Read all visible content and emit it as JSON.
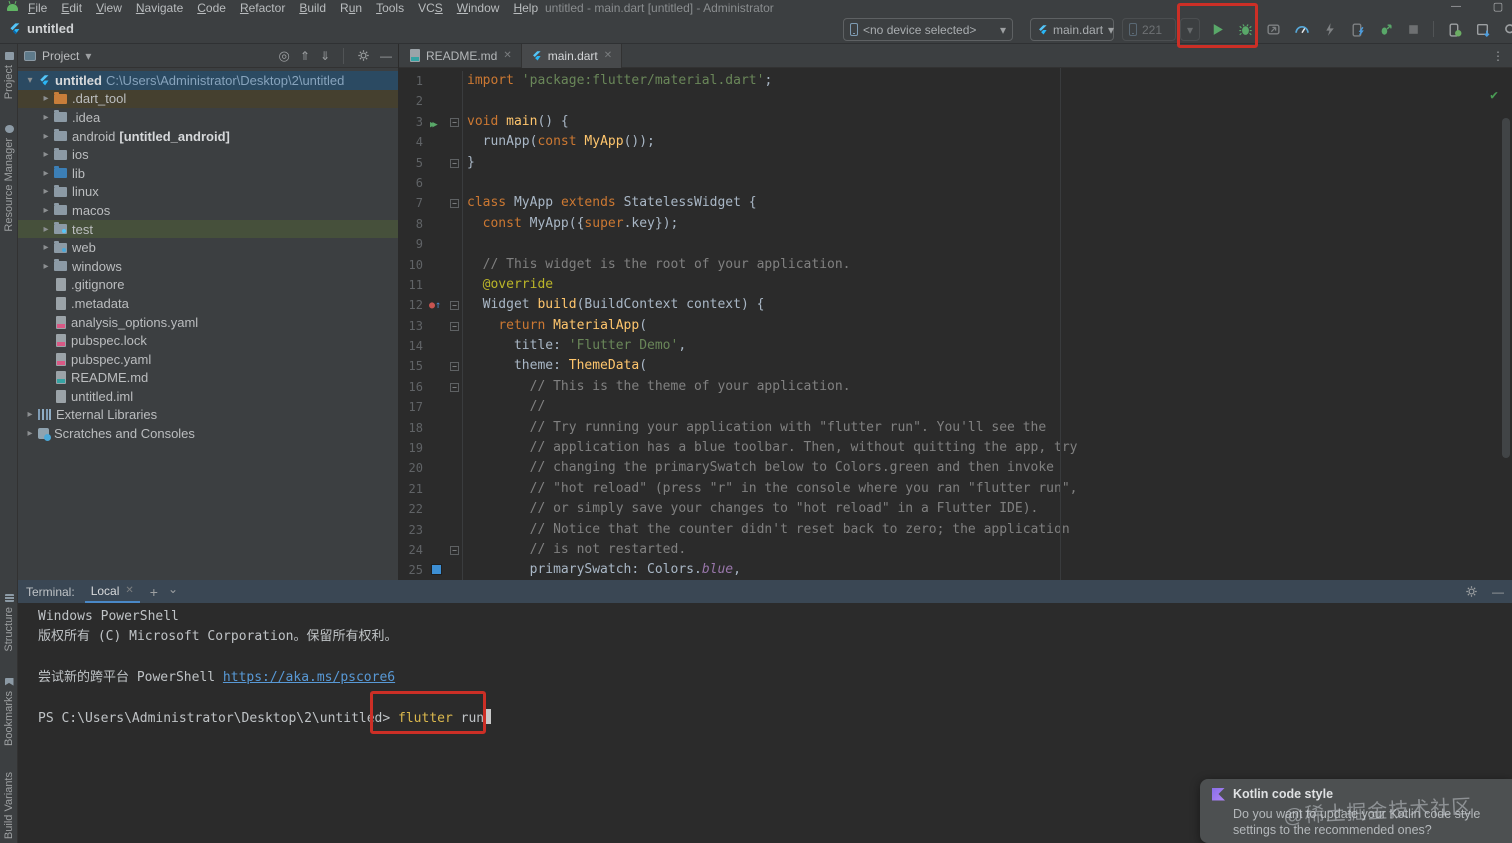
{
  "window": {
    "title": "untitled - main.dart [untitled] - Administrator"
  },
  "menubar": {
    "items": [
      {
        "label": "File",
        "m": 0
      },
      {
        "label": "Edit",
        "m": 0
      },
      {
        "label": "View",
        "m": 0
      },
      {
        "label": "Navigate",
        "m": 0
      },
      {
        "label": "Code",
        "m": 0
      },
      {
        "label": "Refactor",
        "m": 0
      },
      {
        "label": "Build",
        "m": 0
      },
      {
        "label": "Run",
        "m": 1
      },
      {
        "label": "Tools",
        "m": 0
      },
      {
        "label": "VCS",
        "m": 2
      },
      {
        "label": "Window",
        "m": 0
      },
      {
        "label": "Help",
        "m": 0
      }
    ]
  },
  "navbar": {
    "breadcrumb": "untitled"
  },
  "toolbar": {
    "device_selector": "<no device selected>",
    "run_config": "main.dart",
    "api_level": "221",
    "action_icons": [
      "profile-icon",
      "devtools-icon",
      "hot-reload-icon",
      "attach-debugger-icon",
      "flutter-attach-icon",
      "stop-icon",
      "device-manager-icon",
      "sdk-manager-icon",
      "search-icon",
      "settings-icon"
    ]
  },
  "left_stripe": {
    "top": [
      {
        "label": "Project"
      },
      {
        "label": "Resource Manager"
      }
    ],
    "bottom": [
      {
        "label": "Structure"
      },
      {
        "label": "Bookmarks"
      },
      {
        "label": "Build Variants"
      }
    ]
  },
  "project_panel": {
    "header": {
      "title": "Project"
    },
    "tree": [
      {
        "label": "untitled",
        "suffix": "C:\\Users\\Administrator\\Desktop\\2\\untitled",
        "icon": "flutter",
        "chev": "open",
        "level": 0,
        "bg": "sel-blue",
        "bold": true,
        "suffixClass": "path-suffix"
      },
      {
        "label": ".dart_tool",
        "icon": "folder-orange",
        "chev": "closed",
        "level": 1,
        "bg": "row-brown"
      },
      {
        "label": ".idea",
        "icon": "folder",
        "chev": "closed",
        "level": 1
      },
      {
        "label": "android",
        "suffix": "[untitled_android]",
        "icon": "folder",
        "chev": "closed",
        "level": 1,
        "suffixClass": "bold"
      },
      {
        "label": "ios",
        "icon": "folder",
        "chev": "closed",
        "level": 1
      },
      {
        "label": "lib",
        "icon": "folder-blue",
        "chev": "closed",
        "level": 1
      },
      {
        "label": "linux",
        "icon": "folder",
        "chev": "closed",
        "level": 1
      },
      {
        "label": "macos",
        "icon": "folder",
        "chev": "closed",
        "level": 1
      },
      {
        "label": "test",
        "icon": "folder-test",
        "chev": "closed",
        "level": 1,
        "bg": "row-olive"
      },
      {
        "label": "web",
        "icon": "folder-web",
        "chev": "closed",
        "level": 1
      },
      {
        "label": "windows",
        "icon": "folder",
        "chev": "closed",
        "level": 1
      },
      {
        "label": ".gitignore",
        "icon": "file",
        "level": 1
      },
      {
        "label": ".metadata",
        "icon": "file",
        "level": 1
      },
      {
        "label": "analysis_options.yaml",
        "icon": "yaml",
        "level": 1
      },
      {
        "label": "pubspec.lock",
        "icon": "yaml",
        "level": 1
      },
      {
        "label": "pubspec.yaml",
        "icon": "yaml",
        "level": 1
      },
      {
        "label": "README.md",
        "icon": "md",
        "level": 1
      },
      {
        "label": "untitled.iml",
        "icon": "iml",
        "level": 1
      },
      {
        "label": "External Libraries",
        "icon": "libs",
        "chev": "closed",
        "level": 0
      },
      {
        "label": "Scratches and Consoles",
        "icon": "scratch",
        "chev": "closed",
        "level": 0
      }
    ]
  },
  "editor": {
    "tabs": [
      {
        "label": "README.md"
      },
      {
        "label": "main.dart",
        "active": true
      }
    ],
    "gutter": {
      "run_line": 3,
      "override_line": 12,
      "color_line": 25,
      "fold_lines": [
        3,
        5,
        7,
        12,
        13,
        15,
        16,
        24
      ]
    },
    "lines": [
      [
        [
          "k",
          "import "
        ],
        [
          "s",
          "'package:flutter/material.dart'"
        ],
        [
          "w",
          ";"
        ]
      ],
      [],
      [
        [
          "k",
          "void "
        ],
        [
          "y",
          "main"
        ],
        [
          "w",
          "() {"
        ]
      ],
      [
        [
          "w",
          "  runApp("
        ],
        [
          "k",
          "const "
        ],
        [
          "y",
          "MyApp"
        ],
        [
          "w",
          "());"
        ]
      ],
      [
        [
          "w",
          "}"
        ]
      ],
      [],
      [
        [
          "k",
          "class "
        ],
        [
          "w",
          "MyApp "
        ],
        [
          "k",
          "extends "
        ],
        [
          "w",
          "StatelessWidget {"
        ]
      ],
      [
        [
          "w",
          "  "
        ],
        [
          "k",
          "const "
        ],
        [
          "w",
          "MyApp({"
        ],
        [
          "k",
          "super"
        ],
        [
          "w",
          ".key});"
        ]
      ],
      [],
      [
        [
          "w",
          "  "
        ],
        [
          "c",
          "// This widget is the root of your application."
        ]
      ],
      [
        [
          "w",
          "  "
        ],
        [
          "a",
          "@override"
        ]
      ],
      [
        [
          "w",
          "  Widget "
        ],
        [
          "y",
          "build"
        ],
        [
          "w",
          "(BuildContext context) {"
        ]
      ],
      [
        [
          "w",
          "    "
        ],
        [
          "k",
          "return "
        ],
        [
          "y",
          "MaterialApp"
        ],
        [
          "w",
          "("
        ]
      ],
      [
        [
          "w",
          "      title: "
        ],
        [
          "s",
          "'Flutter Demo'"
        ],
        [
          "w",
          ","
        ]
      ],
      [
        [
          "w",
          "      theme: "
        ],
        [
          "y",
          "ThemeData"
        ],
        [
          "w",
          "("
        ]
      ],
      [
        [
          "w",
          "        "
        ],
        [
          "c",
          "// This is the theme of your application."
        ]
      ],
      [
        [
          "w",
          "        "
        ],
        [
          "c",
          "//"
        ]
      ],
      [
        [
          "w",
          "        "
        ],
        [
          "c",
          "// Try running your application with \"flutter run\". You'll see the"
        ]
      ],
      [
        [
          "w",
          "        "
        ],
        [
          "c",
          "// application has a blue toolbar. Then, without quitting the app, try"
        ]
      ],
      [
        [
          "w",
          "        "
        ],
        [
          "c",
          "// changing the primarySwatch below to Colors.green and then invoke"
        ]
      ],
      [
        [
          "w",
          "        "
        ],
        [
          "c",
          "// \"hot reload\" (press \"r\" in the console where you ran \"flutter run\","
        ]
      ],
      [
        [
          "w",
          "        "
        ],
        [
          "c",
          "// or simply save your changes to \"hot reload\" in a Flutter IDE)."
        ]
      ],
      [
        [
          "w",
          "        "
        ],
        [
          "c",
          "// Notice that the counter didn't reset back to zero; the application"
        ]
      ],
      [
        [
          "w",
          "        "
        ],
        [
          "c",
          "// is not restarted."
        ]
      ],
      [
        [
          "w",
          "        primarySwatch: Colors."
        ],
        [
          "i",
          "blue"
        ],
        [
          "w",
          ","
        ]
      ]
    ]
  },
  "terminal": {
    "label": "Terminal:",
    "tab": "Local",
    "lines": [
      [
        [
          "t",
          "Windows PowerShell"
        ]
      ],
      [
        [
          "t",
          "版权所有 (C) Microsoft Corporation。保留所有权利。"
        ]
      ],
      [],
      [
        [
          "t",
          "尝试新的跨平台 PowerShell "
        ],
        [
          "link",
          "https://aka.ms/pscore6"
        ]
      ],
      [],
      [
        [
          "t",
          "PS C:\\Users\\Administrator\\Desktop\\2\\untitled> "
        ],
        [
          "cmd",
          "flutter"
        ],
        [
          "t",
          " run"
        ],
        [
          "cursor",
          ""
        ]
      ]
    ]
  },
  "notification": {
    "title": "Kotlin code style",
    "body": "Do you want to update your Kotlin code style settings to the recommended ones?"
  },
  "watermark": "@稀土掘金技术社区",
  "colors": {
    "accent_blue": "#4A88C7",
    "run_green": "#59A869",
    "annotation_red": "#CC2F26",
    "keyword": "#CC7832",
    "string": "#6A8759",
    "comment": "#808080"
  }
}
